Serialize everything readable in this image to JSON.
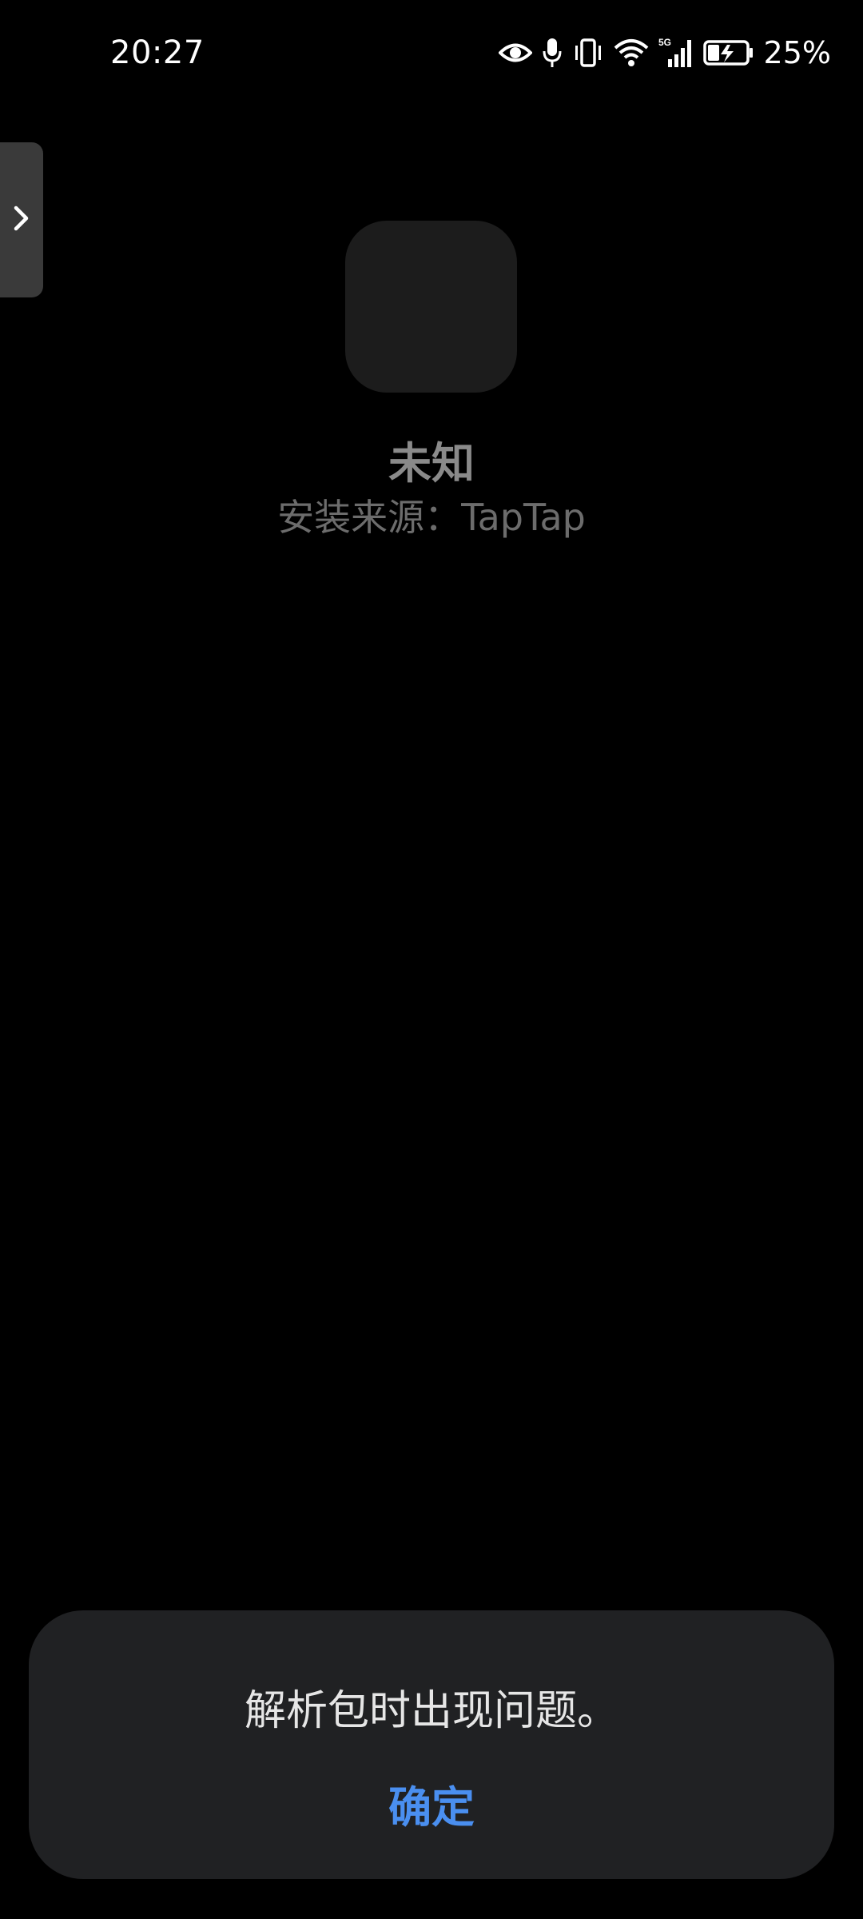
{
  "status_bar": {
    "time": "20:27",
    "icons": [
      "eye-icon",
      "microphone-icon",
      "vibrate-icon",
      "wifi-icon",
      "cellular-5g-icon",
      "battery-charging-icon"
    ],
    "network_type": "5G",
    "battery_percent": "25%"
  },
  "side_tab": {
    "icon": "chevron-right-icon"
  },
  "app": {
    "name": "未知",
    "install_source": "安装来源：TapTap"
  },
  "dialog": {
    "message": "解析包时出现问题。",
    "confirm_label": "确定"
  },
  "colors": {
    "background": "#000000",
    "dialog_bg": "#202123",
    "accent": "#4a8ff0",
    "app_icon_bg": "#1c1c1c"
  }
}
